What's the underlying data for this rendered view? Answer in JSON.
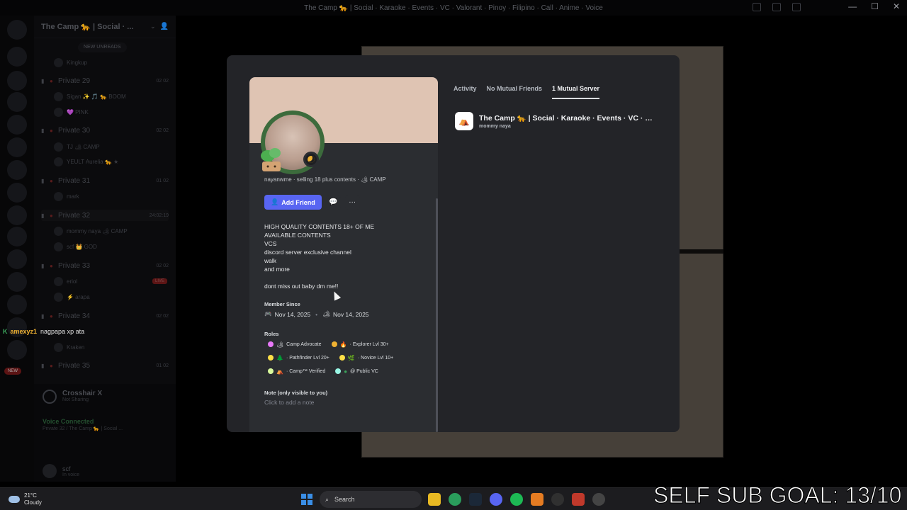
{
  "window": {
    "title": "The Camp 🐆 | Social · Karaoke · Events · VC · Valorant · Pinoy · Filipino · Call · Anime · Voice"
  },
  "server": {
    "name": "The Camp 🐆 | Social · ...",
    "new_unreads": "NEW UNREADS"
  },
  "channels": [
    {
      "name": "Private 29",
      "count": "02 02"
    },
    {
      "name": "Private 30",
      "count": "02 02"
    },
    {
      "name": "Private 31",
      "count": "01 02"
    },
    {
      "name": "Private 32",
      "count": "24:02:19"
    },
    {
      "name": "Private 33",
      "count": "02 02"
    },
    {
      "name": "Private 34",
      "count": "02 02"
    },
    {
      "name": "Private 35",
      "count": "01 02"
    }
  ],
  "voice_users": [
    {
      "name": "Kingkup"
    },
    {
      "name": "Sigan ✨ 🎵 🐆 BOOM"
    },
    {
      "name": "💜 PINK"
    },
    {
      "name": "TJ 🏕 CAMP"
    },
    {
      "name": "YEULT Aurelia 🐆 ★"
    },
    {
      "name": "mark"
    },
    {
      "name": "mommy naya 🏕 CAMP"
    },
    {
      "name": "scf 👑 GOD"
    },
    {
      "name": "eriol",
      "badge": "LIVE"
    },
    {
      "name": "⚡ arapa"
    },
    {
      "name": "Kraken"
    }
  ],
  "chat_overlay": {
    "badge": "K",
    "user": "amexyz1",
    "message": "nagpapa xp ata"
  },
  "rail_new_badge": "NEW",
  "crosshair": {
    "title": "Crosshair X",
    "subtitle": "Not Sharing"
  },
  "voice_status": {
    "title": "Voice Connected",
    "subtitle": "Private 32 / The Camp 🐆 | Social ..."
  },
  "user_panel": {
    "name": "scf",
    "status": "In voice"
  },
  "profile": {
    "cutline": "nayanwme · selling 18 plus contents · 🏕 CAMP",
    "add_friend_label": "Add Friend",
    "bio": [
      "HIGH QUALITY CONTENTS 18+ OF ME",
      "AVAILABLE CONTENTS",
      "VCS",
      "discord server exclusive channel",
      "walk",
      "and more",
      "",
      "dont miss out baby dm me!!"
    ],
    "member_since_label": "Member Since",
    "member_since_discord": "Nov 14, 2025",
    "member_since_server": "Nov 14, 2025",
    "roles_label": "Roles",
    "roles": [
      {
        "name": "Camp Advocate",
        "color": "#e879f9",
        "icon": "🏕"
      },
      {
        "name": "· Explorer Lvl 30+",
        "color": "#f0b232",
        "icon": "🔥"
      },
      {
        "name": "· Pathfinder Lvl 20+",
        "color": "#fde047",
        "icon": "🌲"
      },
      {
        "name": "· Novice Lvl 10+",
        "color": "#fde047",
        "icon": "🌿"
      },
      {
        "name": "· Camp™ Verified",
        "color": "#d9f99d",
        "icon": "⛺"
      },
      {
        "name": "@ Public VC",
        "color": "#99f6e4",
        "icon": "●"
      }
    ],
    "note_label": "Note (only visible to you)",
    "note_placeholder": "Click to add a note"
  },
  "tabs": [
    {
      "label": "Activity"
    },
    {
      "label": "No Mutual Friends"
    },
    {
      "label": "1 Mutual Server"
    }
  ],
  "mutual_server": {
    "name": "The Camp 🐆 | Social · Karaoke · Events · VC · Valora...",
    "nickname": "mommy naya"
  },
  "taskbar": {
    "temperature": "21°C",
    "weather": "Cloudy",
    "search_label": "Search"
  },
  "stream_overlay": "SELF SUB GOAL: 13/10"
}
